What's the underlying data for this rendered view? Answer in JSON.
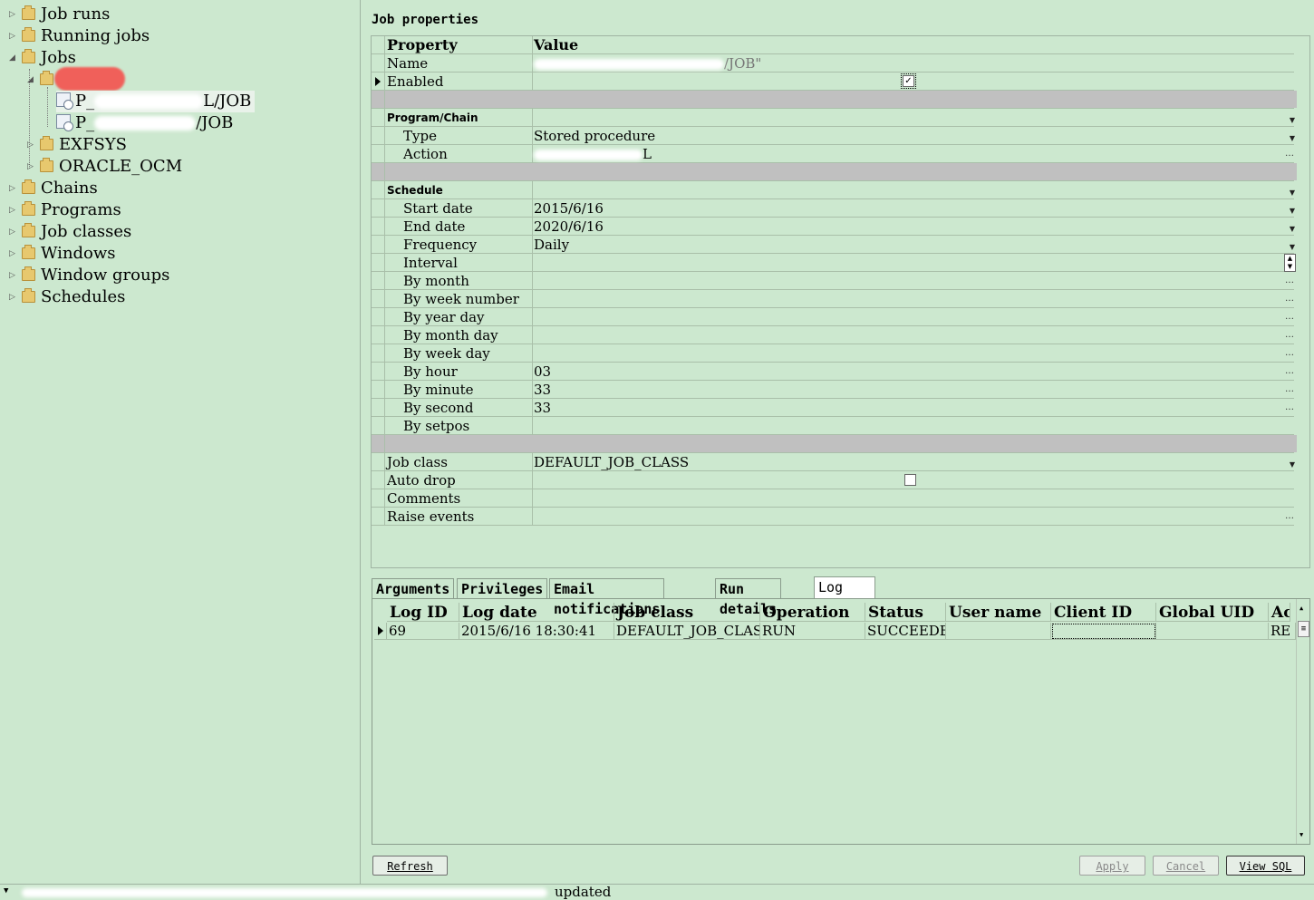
{
  "tree": {
    "job_runs": "Job runs",
    "running_jobs": "Running jobs",
    "jobs": "Jobs",
    "job1_prefix": "P_",
    "job1_suffix": "L/JOB",
    "job2_prefix": "P_",
    "job2_suffix": "/JOB",
    "exfsys": "EXFSYS",
    "oracle_ocm": "ORACLE_OCM",
    "chains": "Chains",
    "programs": "Programs",
    "job_classes": "Job classes",
    "windows": "Windows",
    "window_groups": "Window groups",
    "schedules": "Schedules"
  },
  "props": {
    "title": "Job properties",
    "header_property": "Property",
    "header_value": "Value",
    "name_label": "Name",
    "name_value_suffix": "/JOB\"",
    "enabled_label": "Enabled",
    "program_chain": "Program/Chain",
    "type_label": "Type",
    "type_value": "Stored procedure",
    "action_label": "Action",
    "action_value_suffix": "L",
    "schedule": "Schedule",
    "start_date_label": "Start date",
    "start_date_value": "2015/6/16",
    "end_date_label": "End date",
    "end_date_value": "2020/6/16",
    "frequency_label": "Frequency",
    "frequency_value": "Daily",
    "interval_label": "Interval",
    "by_month_label": "By month",
    "by_week_number_label": "By week number",
    "by_year_day_label": "By year day",
    "by_month_day_label": "By month day",
    "by_week_day_label": "By week day",
    "by_hour_label": "By hour",
    "by_hour_value": "03",
    "by_minute_label": "By minute",
    "by_minute_value": "33",
    "by_second_label": "By second",
    "by_second_value": "33",
    "by_setpos_label": "By setpos",
    "job_class_label": "Job class",
    "job_class_value": "DEFAULT_JOB_CLASS",
    "auto_drop_label": "Auto drop",
    "comments_label": "Comments",
    "raise_events_label": "Raise events"
  },
  "tabs": {
    "arguments": "Arguments",
    "privileges": "Privileges",
    "email": "Email notifications",
    "run_details": "Run details",
    "log": "Log"
  },
  "log": {
    "col_log_id": "Log ID",
    "col_log_date": "Log date",
    "col_job_class": "Job class",
    "col_operation": "Operation",
    "col_status": "Status",
    "col_user_name": "User name",
    "col_client_id": "Client ID",
    "col_global_uid": "Global UID",
    "col_ac": "Ac",
    "row_log_id": "69",
    "row_log_date": "2015/6/16 18:30:41",
    "row_job_class": "DEFAULT_JOB_CLASS",
    "row_operation": "RUN",
    "row_status": "SUCCEEDED",
    "row_ac": "RE"
  },
  "buttons": {
    "refresh": "Refresh",
    "apply": "Apply",
    "cancel": "Cancel",
    "view_sql": "View SQL"
  },
  "status": {
    "text": "updated"
  }
}
